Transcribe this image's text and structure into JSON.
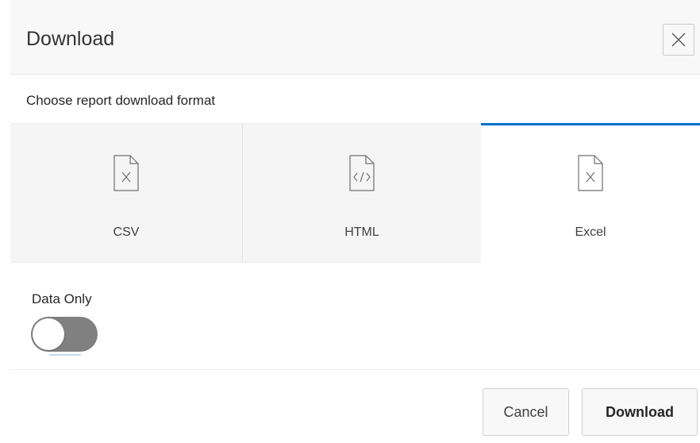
{
  "dialog": {
    "title": "Download",
    "close_icon": "close-icon",
    "subtitle": "Choose report download format"
  },
  "formats": [
    {
      "label": "CSV",
      "icon": "file-x-icon",
      "selected": false
    },
    {
      "label": "HTML",
      "icon": "file-code-icon",
      "selected": false
    },
    {
      "label": "Excel",
      "icon": "file-x-icon",
      "selected": true
    }
  ],
  "options": {
    "data_only_label": "Data Only",
    "data_only_enabled": false
  },
  "footer": {
    "cancel_label": "Cancel",
    "download_label": "Download"
  },
  "colors": {
    "accent": "#0572ce",
    "tile_bg": "#f5f5f5",
    "toggle_off": "#808080"
  }
}
